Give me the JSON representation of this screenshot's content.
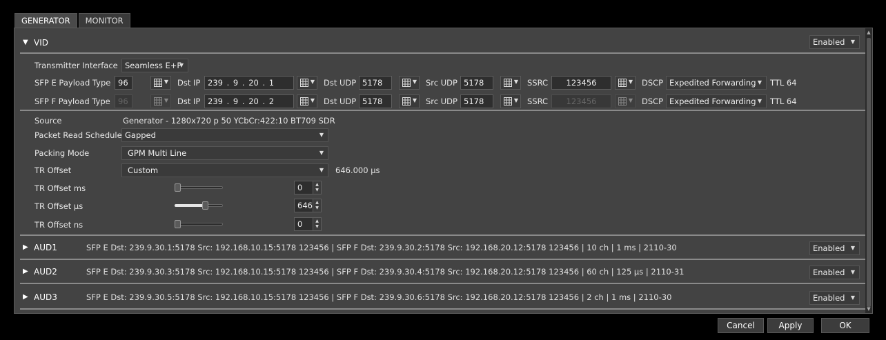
{
  "tabs": [
    "GENERATOR",
    "MONITOR"
  ],
  "vid": {
    "name": "VID",
    "state": "Enabled",
    "transmitter_interface_label": "Transmitter Interface",
    "transmitter_interface_value": "Seamless E+F",
    "sfp_e": {
      "payload_label": "SFP E Payload Type",
      "payload": "96",
      "dst_ip_label": "Dst IP",
      "dst_ip": "239 . 9 . 20 . 1",
      "dst_udp_label": "Dst UDP",
      "dst_udp": "5178",
      "src_udp_label": "Src UDP",
      "src_udp": "5178",
      "ssrc_label": "SSRC",
      "ssrc": "123456",
      "dscp_label": "DSCP",
      "dscp": "Expedited Forwarding",
      "ttl": "TTL 64"
    },
    "sfp_f": {
      "payload_label": "SFP F Payload Type",
      "payload": "96",
      "dst_ip_label": "Dst IP",
      "dst_ip": "239 . 9 . 20 . 2",
      "dst_udp_label": "Dst UDP",
      "dst_udp": "5178",
      "src_udp_label": "Src UDP",
      "src_udp": "5178",
      "ssrc_label": "SSRC",
      "ssrc": "123456",
      "dscp_label": "DSCP",
      "dscp": "Expedited Forwarding",
      "ttl": "TTL 64"
    },
    "source_label": "Source",
    "source_value": "Generator - 1280x720 p 50 YCbCr:422:10 BT709 SDR",
    "packet_read_label": "Packet Read Schedule",
    "packet_read_value": "Gapped",
    "packing_mode_label": "Packing Mode",
    "packing_mode_value": "GPM Multi Line",
    "tr_offset_label": "TR Offset",
    "tr_offset_value": "Custom",
    "tr_offset_readout": "646.000 µs",
    "tr_ms_label": "TR Offset ms",
    "tr_ms_value": "0",
    "tr_ms_fraction": 0.0,
    "tr_us_label": "TR Offset µs",
    "tr_us_value": "646",
    "tr_us_fraction": 0.65,
    "tr_ns_label": "TR Offset ns",
    "tr_ns_value": "0",
    "tr_ns_fraction": 0.0
  },
  "audio": [
    {
      "name": "AUD1",
      "summary": "SFP E Dst: 239.9.30.1:5178 Src: 192.168.10.15:5178 123456 | SFP F Dst: 239.9.30.2:5178 Src: 192.168.20.12:5178 123456 | 10 ch | 1 ms | 2110-30",
      "state": "Enabled"
    },
    {
      "name": "AUD2",
      "summary": "SFP E Dst: 239.9.30.3:5178 Src: 192.168.10.15:5178 123456 | SFP F Dst: 239.9.30.4:5178 Src: 192.168.20.12:5178 123456 | 60 ch | 125 µs | 2110-31",
      "state": "Enabled"
    },
    {
      "name": "AUD3",
      "summary": "SFP E Dst: 239.9.30.5:5178 Src: 192.168.10.15:5178 123456 | SFP F Dst: 239.9.30.6:5178 Src: 192.168.20.12:5178 123456 | 2 ch | 1 ms | 2110-30",
      "state": "Enabled"
    }
  ],
  "buttons": {
    "cancel": "Cancel",
    "apply": "Apply",
    "ok": "OK"
  },
  "icons": {
    "expanded": "triangle-down-icon",
    "collapsed": "triangle-right-icon",
    "grid": "grid-icon",
    "caret": "caret-down-icon"
  }
}
